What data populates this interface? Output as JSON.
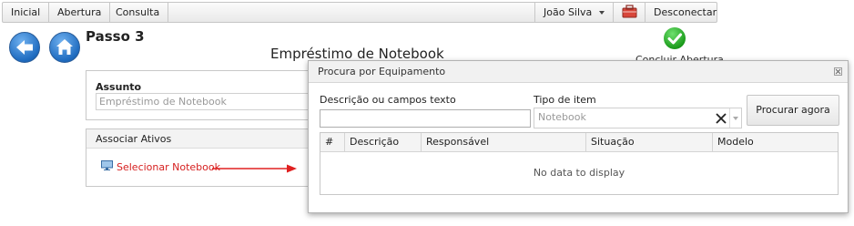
{
  "nav": {
    "items": [
      "Inicial",
      "Abertura",
      "Consulta"
    ],
    "user": "João Silva",
    "toolbox_icon": "toolbox-icon",
    "disconnect": "Desconectar"
  },
  "step": "Passo 3",
  "page_title": "Empréstimo de Notebook",
  "concluir": {
    "label": "Concluir Abertura",
    "icon": "check-circle-icon",
    "color": "#22a022"
  },
  "assunto": {
    "label": "Assunto",
    "placeholder": "Empréstimo de Notebook"
  },
  "ativos": {
    "header": "Associar Ativos",
    "link": "Selecionar Notebook",
    "link_color": "#d62020"
  },
  "dialog": {
    "title": "Procura por Equipamento",
    "desc_label": "Descrição ou campos texto",
    "desc_value": "",
    "tipo_label": "Tipo de item",
    "tipo_placeholder": "Notebook",
    "search_button": "Procurar agora",
    "columns": [
      "#",
      "Descrição",
      "Responsável",
      "Situação",
      "Modelo"
    ],
    "empty_text": "No data to display"
  }
}
